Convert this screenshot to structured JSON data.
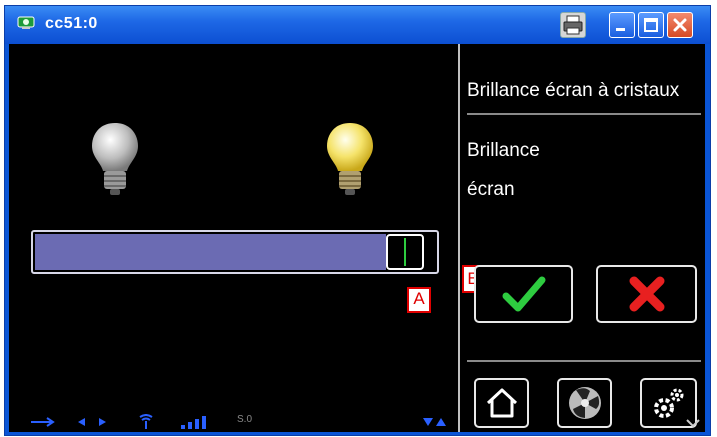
{
  "window": {
    "title": "cc51:0"
  },
  "panel": {
    "title": "Brillance écran à cristaux",
    "description_line1": "Brillance",
    "description_line2": "écran"
  },
  "slider": {
    "value_fraction": 0.97
  },
  "annotations": {
    "a": "A",
    "b": "B"
  },
  "status_bar": {
    "network_label": "S.0"
  },
  "colors": {
    "title_bar": "#1e68e6",
    "slider_fill": "#6b6bb3",
    "confirm": "#2ecc40",
    "cancel": "#e82020"
  },
  "icons": {
    "app": "monitor-icon",
    "printer": "printer-icon",
    "minimize": "minimize-icon",
    "maximize": "maximize-icon",
    "close": "close-icon",
    "bulb_off": "bulb-off-icon",
    "bulb_on": "bulb-on-icon",
    "confirm": "checkmark-icon",
    "cancel": "x-icon",
    "home": "home-icon",
    "fan": "fan-icon",
    "settings": "gears-icon"
  }
}
